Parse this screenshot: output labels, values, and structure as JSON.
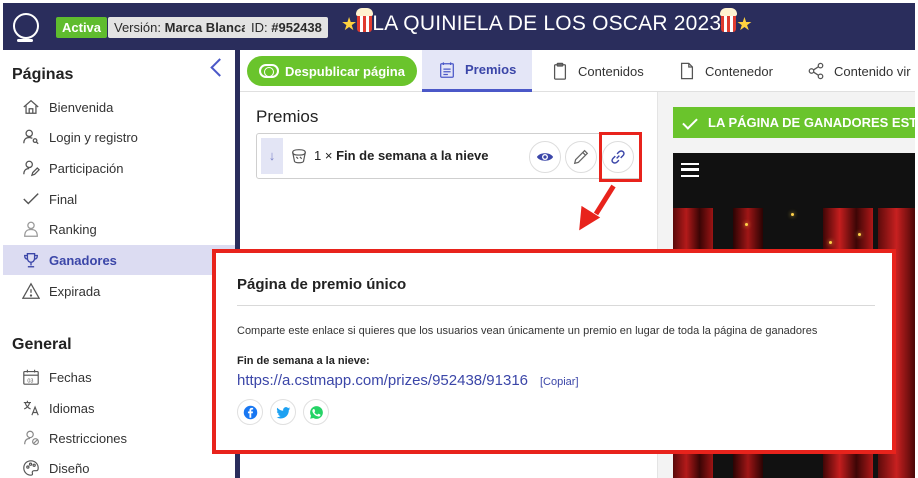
{
  "header": {
    "status_badge": "Activa",
    "version_label": "Versión:",
    "version_value": "Marca Blanca",
    "id_label": "ID:",
    "id_value": "#952438",
    "title": "LA QUINIELA DE LOS OSCAR 2023"
  },
  "sidebar": {
    "pages_title": "Páginas",
    "pages": [
      {
        "label": "Bienvenida",
        "icon": "home-icon"
      },
      {
        "label": "Login y registro",
        "icon": "user-key-icon"
      },
      {
        "label": "Participación",
        "icon": "user-edit-icon"
      },
      {
        "label": "Final",
        "icon": "check-icon"
      },
      {
        "label": "Ranking",
        "icon": "ranking-icon"
      },
      {
        "label": "Ganadores",
        "icon": "trophy-icon",
        "active": true
      },
      {
        "label": "Expirada",
        "icon": "warning-icon"
      }
    ],
    "general_title": "General",
    "general": [
      {
        "label": "Fechas",
        "icon": "calendar-icon"
      },
      {
        "label": "Idiomas",
        "icon": "translate-icon"
      },
      {
        "label": "Restricciones",
        "icon": "restriction-icon"
      },
      {
        "label": "Diseño",
        "icon": "palette-icon"
      }
    ]
  },
  "toolbar": {
    "unpublish_label": "Despublicar página",
    "tabs": [
      {
        "label": "Premios",
        "icon": "list-icon",
        "active": true
      },
      {
        "label": "Contenidos",
        "icon": "clipboard-icon"
      },
      {
        "label": "Contenedor",
        "icon": "file-icon"
      },
      {
        "label": "Contenido vir",
        "icon": "share-icon"
      }
    ]
  },
  "prizes": {
    "title": "Premios",
    "drag_arrow": "↓",
    "item_quantity": "1 ×",
    "item_name": "Fin de semana a la nieve"
  },
  "preview": {
    "banner": "LA PÁGINA DE GANADORES EST"
  },
  "popup": {
    "title": "Página de premio único",
    "description": "Comparte este enlace si quieres que los usuarios vean únicamente un premio en lugar de toda la página de ganadores",
    "prize_label": "Fin de semana a la nieve:",
    "link": "https://a.cstmapp.com/prizes/952438/91316",
    "copy_label": "[Copiar]"
  },
  "colors": {
    "navy": "#2a2d5c",
    "green": "#6ac42c",
    "accent": "#3b46a8",
    "highlight_red": "#e8231c",
    "facebook": "#1877f2",
    "twitter": "#1da1f2",
    "whatsapp": "#25d366"
  }
}
